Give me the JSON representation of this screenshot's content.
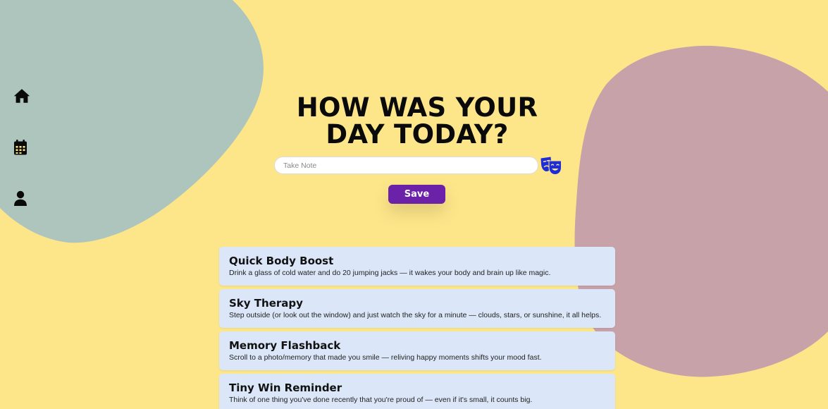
{
  "theme": {
    "background": "#fde68a",
    "blob_left": "#adc5bd",
    "blob_right": "#c8a2a9",
    "accent": "#6b21a8",
    "card_background": "#dbe7f8",
    "mood_icon_color": "#1d2ed8"
  },
  "sidebar": {
    "items": [
      {
        "icon": "home-icon",
        "label": "Home"
      },
      {
        "icon": "calendar-icon",
        "label": "Calendar"
      },
      {
        "icon": "user-icon",
        "label": "Profile"
      }
    ]
  },
  "main": {
    "heading_line1": "HOW WAS YOUR",
    "heading_line2": "DAY TODAY?",
    "note_placeholder": "Take Note",
    "note_value": "",
    "mood_icon": "theater-masks-icon",
    "save_label": "Save"
  },
  "tips": [
    {
      "title": "Quick Body Boost",
      "description": "Drink a glass of cold water and do 20 jumping jacks — it wakes your body and brain up like magic."
    },
    {
      "title": "Sky Therapy",
      "description": "Step outside (or look out the window) and just watch the sky for a minute — clouds, stars, or sunshine, it all helps."
    },
    {
      "title": "Memory Flashback",
      "description": "Scroll to a photo/memory that made you smile — reliving happy moments shifts your mood fast."
    },
    {
      "title": "Tiny Win Reminder",
      "description": "Think of one thing you've done recently that you're proud of — even if it's small, it counts big."
    }
  ]
}
